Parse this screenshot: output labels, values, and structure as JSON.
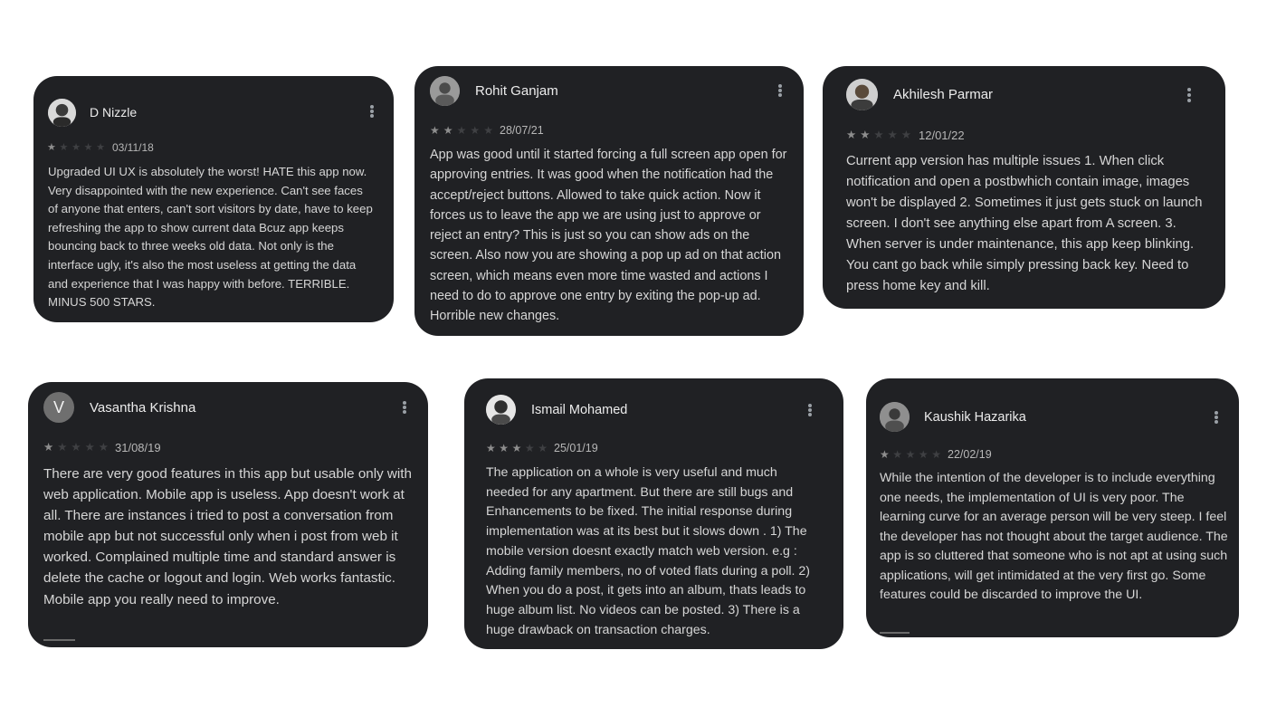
{
  "colors": {
    "card_background": "#202124",
    "star_filled": "#8e8e8e",
    "star_empty": "#3f4043"
  },
  "reviews": [
    {
      "name": "D Nizzle",
      "avatar": "photo-avatar",
      "rating": 1,
      "stars_total": 5,
      "date": "03/11/18",
      "text": "Upgraded UI UX is absolutely the worst! HATE this app now. Very disappointed with the new experience. Can't see faces of anyone that enters, can't sort visitors by date, have to keep refreshing the app to show current data Bcuz app keeps bouncing back to three weeks old data. Not only is the interface ugly, it's also the most useless at getting the data and experience that I was happy with before. TERRIBLE. MINUS 500 STARS."
    },
    {
      "name": "Rohit Ganjam",
      "avatar": "photo-avatar",
      "rating": 2,
      "stars_total": 5,
      "date": "28/07/21",
      "text": "App was good until it started forcing a full screen app open for approving entries. It was good when the notification had the accept/reject buttons. Allowed to take quick action. Now it forces us to leave the app we are using just to approve or reject an entry? This is just so you can show ads on the screen. Also now you are showing a pop up ad on that action screen, which means even more time wasted and actions I need to do to approve one entry by exiting the pop-up ad. Horrible new changes."
    },
    {
      "name": "Akhilesh Parmar",
      "avatar": "photo-avatar",
      "rating": 2,
      "stars_total": 5,
      "date": "12/01/22",
      "text": "Current app version has multiple issues 1. When click notification and open a postbwhich contain image, images won't be displayed 2. Sometimes it just gets stuck on launch screen. I don't see anything else apart from A screen. 3. When server is under maintenance, this app keep blinking. You cant go back while simply pressing back key. Need to press home key and kill."
    },
    {
      "name": "Vasantha Krishna",
      "avatar": "letter-avatar",
      "avatar_letter": "V",
      "rating": 1,
      "stars_total": 5,
      "date": "31/08/19",
      "text": "There are very good features in this app but usable only with web application. Mobile app is useless. App doesn't work at all. There are instances i tried to post a conversation from mobile app but not successful only when i post from web it worked. Complained multiple time and standard answer is delete the cache or logout and login. Web works fantastic. Mobile app you really need to improve."
    },
    {
      "name": "Ismail Mohamed",
      "avatar": "photo-avatar",
      "rating": 3,
      "stars_total": 5,
      "date": "25/01/19",
      "text": "The application on a whole is very useful and much needed for any apartment. But there are still bugs and Enhancements to be fixed. The initial response during implementation was at its best but it slows down . 1) The mobile version doesnt exactly match web version. e.g : Adding family members, no of voted flats during a poll. 2) When you do a post, it gets into an album, thats leads to huge album list. No videos can be posted. 3) There is a huge drawback on transaction charges."
    },
    {
      "name": "Kaushik Hazarika",
      "avatar": "photo-avatar",
      "rating": 1,
      "stars_total": 5,
      "date": "22/02/19",
      "text": "While the intention of the developer is to include everything one needs, the implementation of UI is very poor. The learning curve for an average person will be very steep. I feel the developer has not thought about the target audience. The app is so cluttered that someone who is not apt at using such applications, will get intimidated at the very first go. Some features could be discarded to improve the UI."
    }
  ]
}
